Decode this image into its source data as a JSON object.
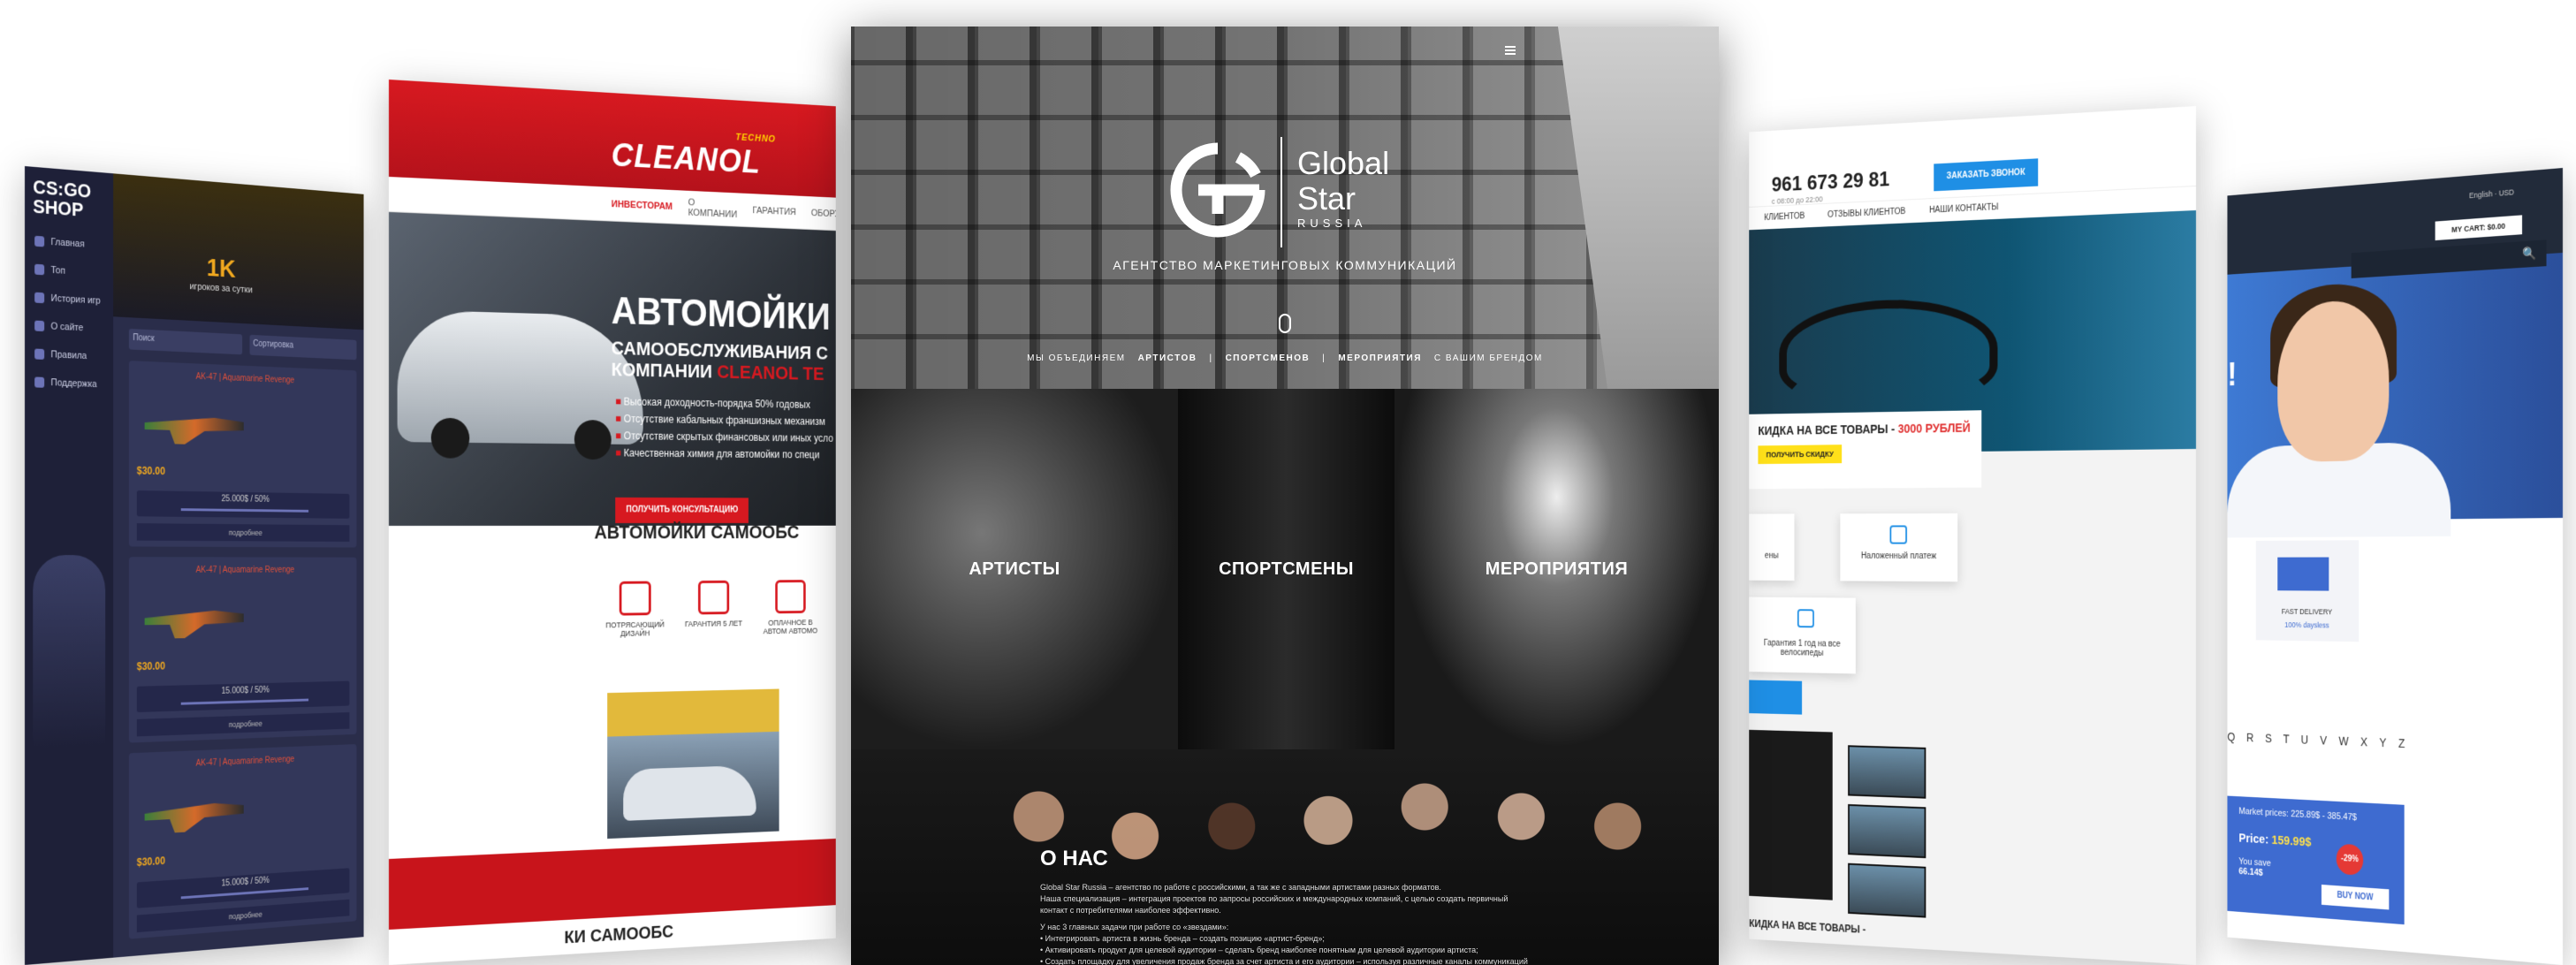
{
  "csgo": {
    "logo": "CS:GO SHOP",
    "nav": [
      "Главная",
      "Топ",
      "История игр",
      "О сайте",
      "Правила",
      "Поддержка"
    ],
    "stat_value": "1K",
    "stat_label": "игроков за сутки",
    "filter_search": "Поиск",
    "filter_sort": "Сортировка",
    "items": [
      {
        "name": "AK-47 | Aquamarine Revenge",
        "price": "$30.00",
        "progress": "25.000$ / 50%",
        "button": "подробнее"
      },
      {
        "name": "AK-47 | Aquamarine Revenge",
        "price": "$30.00",
        "progress": "15.000$ / 50%",
        "button": "подробнее"
      },
      {
        "name": "AK-47 | Aquamarine Revenge",
        "price": "$30.00",
        "progress": "15.000$ / 50%",
        "button": "подробнее"
      }
    ]
  },
  "cleanol": {
    "brand": "CLEANOL",
    "brand_tag": "TECHNO",
    "menu": [
      "ИНВЕСТОРАМ",
      "О КОМПАНИИ",
      "ГАРАНТИЯ",
      "ОБОРУ"
    ],
    "title": "АВТОМОЙКИ",
    "subtitle_1": "САМООБСЛУЖИВАНИЯ С",
    "subtitle_2a": "КОМПАНИИ ",
    "subtitle_2b": "CLEANOL TE",
    "bullets": [
      "Высокая доходность-порядка 50% годовых",
      "Отсутствие кабальных франшизных механизм",
      "Отсутствие скрытых финансовых или иных усло",
      "Качественная химия для автомойки по специ"
    ],
    "cta": "ПОЛУЧИТЬ КОНСУЛЬТАЦИЮ",
    "section_title": "АВТОМОЙКИ САМООБС",
    "features": [
      "ПОТРЯСАЮЩИЙ ДИЗАЙН",
      "ГАРАНТИЯ 5 ЛЕТ",
      "ОПЛАЧНОЕ В АВТОМ АВТОМО"
    ],
    "footer_title": "КИ САМООБС"
  },
  "globalstar": {
    "brand_line1": "Global",
    "brand_line2": "Star",
    "brand_line3": "RUSSIA",
    "tagline": "АГЕНТСТВО МАРКЕТИНГОВЫХ КОММУНИКАЦИЙ",
    "sub": [
      "МЫ ОБЪЕДИНЯЕМ",
      "АРТИСТОВ",
      "|",
      "СПОРТСМЕНОВ",
      "|",
      "МЕРОПРИЯТИЯ",
      "С ВАШИМ БРЕНДОМ"
    ],
    "tiles": [
      "АРТИСТЫ",
      "СПОРТСМЕНЫ",
      "МЕРОПРИЯТИЯ"
    ],
    "about_title": "О НАС",
    "about_p1": "Global Star Russia – агентство по работе с российскими, а так же с западными артистами разных форматов.",
    "about_p2": "Наша специализация – интеграция проектов по запросы российских и международных компаний, с целью создать первичный контакт с потребителями наиболее эффективно.",
    "about_p3": "У нас 3 главных задачи при работе со «звездами»:",
    "about_list": [
      "Интегрировать артиста в жизнь бренда – создать позицию «артист-бренд»;",
      "Активировать продукт для целевой аудитории – сделать бренд наиболее понятным для целевой аудитории артиста;",
      "Создать площадку для увеличения продаж бренда за счет артиста и его аудитории – используя различные каналы коммуникаций мы"
    ]
  },
  "bike": {
    "phone": "961 673 29 81",
    "hours": "с 08:00 до 22:00",
    "call_button": "ЗАКАЗАТЬ ЗВОНОК",
    "nav": [
      "КЛИЕНТОВ",
      "ОТЗЫВЫ КЛИЕНТОВ",
      "НАШИ КОНТАКТЫ"
    ],
    "promo_text": "КИДКА НА ВСЕ ТОВАРЫ - ",
    "promo_highlight": "3000 РУБЛЕЙ",
    "promo_button": "ПОЛУЧИТЬ СКИДКУ",
    "tile_1": "Наложенный платеж",
    "tile_2": "Гарантия 1 год на все велосипеды",
    "tile_3": "ены",
    "footer": "КИДКА НА ВСЕ ТОВАРЫ -"
  },
  "pharm": {
    "lang": "English",
    "currency": "USD",
    "cart": "MY CART: $0.00",
    "delivery": "FAST DELIVERY",
    "delivery_sub": "100% daysless",
    "alphabet": "Q R S T U V W X Y Z",
    "market_prices": "Market prices: 225.89$ - 385.47$",
    "price_label": "Price: ",
    "price": "159.99$",
    "discount": "-29%",
    "you_save": "You save",
    "save_amount": "66.14$",
    "buy": "BUY NOW"
  }
}
